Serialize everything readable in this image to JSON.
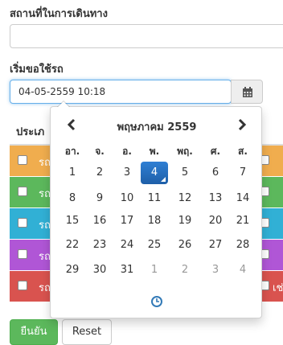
{
  "form": {
    "place_label": "สถานที่ในการเดินทาง",
    "place_value": "",
    "start_label": "เริ่มขอใช้รถ",
    "start_value": "04-05-2559 10:18"
  },
  "table": {
    "header": "ประเภ",
    "rows": [
      {
        "text": "รถ",
        "right": "",
        "color": "#f0ad4e"
      },
      {
        "text": "รถ",
        "right": "",
        "color": "#5cb85c"
      },
      {
        "text": "รถ",
        "right": "",
        "color": "#31b0d5"
      },
      {
        "text": "รถ",
        "right": "",
        "color": "#b056d6"
      },
      {
        "text": "รถ",
        "right": "เช่าก",
        "color": "#d9534f"
      }
    ]
  },
  "buttons": {
    "confirm": "ยืนยัน",
    "reset": "Reset"
  },
  "datepicker": {
    "month_title": "พฤษภาคม 2559",
    "weekdays": [
      "อา.",
      "จ.",
      "อ.",
      "พ.",
      "พฤ.",
      "ศ.",
      "ส."
    ],
    "weeks": [
      [
        "1",
        "2",
        "3",
        "4",
        "5",
        "6",
        "7"
      ],
      [
        "8",
        "9",
        "10",
        "11",
        "12",
        "13",
        "14"
      ],
      [
        "15",
        "16",
        "17",
        "18",
        "19",
        "20",
        "21"
      ],
      [
        "22",
        "23",
        "24",
        "25",
        "26",
        "27",
        "28"
      ],
      [
        "29",
        "30",
        "31",
        "1",
        "2",
        "3",
        "4"
      ]
    ],
    "selected_day": "4",
    "icons": {
      "prev": "chevron-left-icon",
      "next": "chevron-right-icon",
      "time": "clock-icon",
      "calendar": "calendar-icon"
    }
  }
}
